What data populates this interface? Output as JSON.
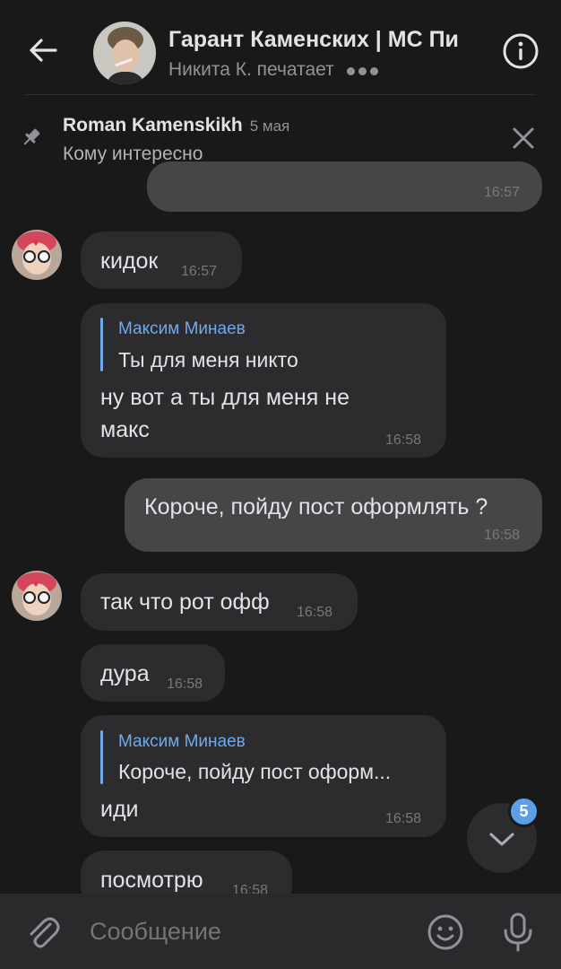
{
  "header": {
    "title": "Гарант Каменских | МС Пи",
    "status": "Никита К. печатает"
  },
  "pinned": {
    "author": "Roman Kamenskikh",
    "date": "5 мая",
    "text": "Кому интересно"
  },
  "messages": [
    {
      "text": "",
      "time": "16:57",
      "out": true
    },
    {
      "text": "кидок",
      "time": "16:57",
      "out": false
    },
    {
      "reply_author": "Максим Минаев",
      "reply_text": "Ты для меня никто",
      "text_line1": "ну вот а ты для меня не",
      "text_line2": "макс",
      "time": "16:58",
      "out": false
    },
    {
      "text": "Короче, пойду пост оформлять ?",
      "time": "16:58",
      "out": true
    },
    {
      "text": "так что рот офф",
      "time": "16:58",
      "out": false
    },
    {
      "text": "дура",
      "time": "16:58",
      "out": false
    },
    {
      "reply_author": "Максим Минаев",
      "reply_text": "Короче, пойду пост оформ...",
      "text": "иди",
      "time": "16:58",
      "out": false
    },
    {
      "text": "посмотрю",
      "time": "16:58",
      "out": false
    }
  ],
  "unread_count": "5",
  "composer": {
    "placeholder": "Сообщение"
  },
  "colors": {
    "accent": "#71aaeb",
    "badge": "#5d9ee5",
    "background": "#19191a",
    "bubble_in": "#2c2c2e",
    "bubble_out": "#454647"
  }
}
